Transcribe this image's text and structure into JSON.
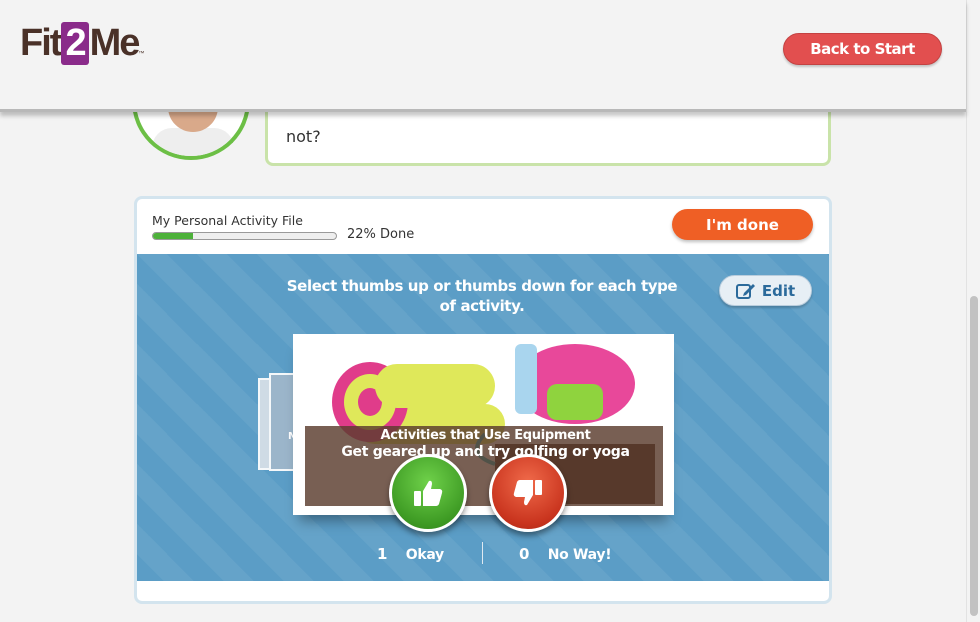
{
  "header": {
    "logo": {
      "prefix": "Fit",
      "number": "2",
      "suffix": "Me",
      "tm": "™"
    },
    "back_button": "Back to Start"
  },
  "bubble": {
    "text": "not?"
  },
  "activity_file": {
    "label": "My Personal Activity File",
    "progress_percent": 22,
    "progress_text": "22% Done",
    "done_button": "I'm done"
  },
  "panel": {
    "instruction": "Select thumbs up or thumbs down for each type of activity.",
    "edit_button": "Edit",
    "behind_card_letter": "M",
    "current_card": {
      "title": "Activities that Use Equipment",
      "subtitle": "Get geared up and try golfing or yoga"
    },
    "tally": {
      "okay_count": "1",
      "okay_label": "Okay",
      "noway_count": "0",
      "noway_label": "No Way!"
    }
  },
  "colors": {
    "brand_brown": "#4a3128",
    "brand_purple": "#8a2b8a",
    "back_button": "#e24f4f",
    "done_button": "#ef5f25",
    "panel_blue": "#5b9dc6",
    "thumbs_up_green": "#3e9b24",
    "thumbs_down_red": "#c9341e",
    "progress_green": "#4db13a"
  }
}
